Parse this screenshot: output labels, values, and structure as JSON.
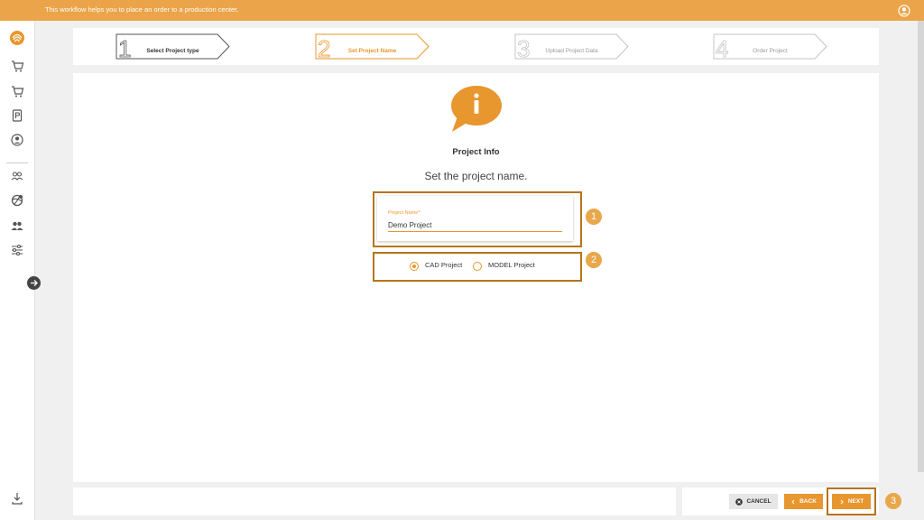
{
  "topbar": {
    "message": "This workflow helps you to place an order to a production center."
  },
  "stepper": {
    "steps": [
      {
        "number": "1",
        "label": "Select Project type",
        "state": "done"
      },
      {
        "number": "2",
        "label": "Set Project Name",
        "state": "active"
      },
      {
        "number": "3",
        "label": "Upload Project Data",
        "state": "pending"
      },
      {
        "number": "4",
        "label": "Order Project",
        "state": "pending"
      }
    ]
  },
  "content": {
    "icon": "info-speech-bubble-icon",
    "title": "Project Info",
    "subtitle": "Set the project name.",
    "field": {
      "label": "Project Name*",
      "value": "Demo Project"
    },
    "radios": [
      {
        "label": "CAD Project",
        "checked": true
      },
      {
        "label": "MODEL Project",
        "checked": false
      }
    ]
  },
  "annotations": [
    "1",
    "2",
    "3"
  ],
  "footer": {
    "cancel_label": "CANCEL",
    "back_label": "BACK",
    "next_label": "NEXT"
  },
  "colors": {
    "accent": "#e8962e",
    "topbar": "#eba449",
    "highlight": "#b8731b",
    "badge": "#e8a74a"
  }
}
